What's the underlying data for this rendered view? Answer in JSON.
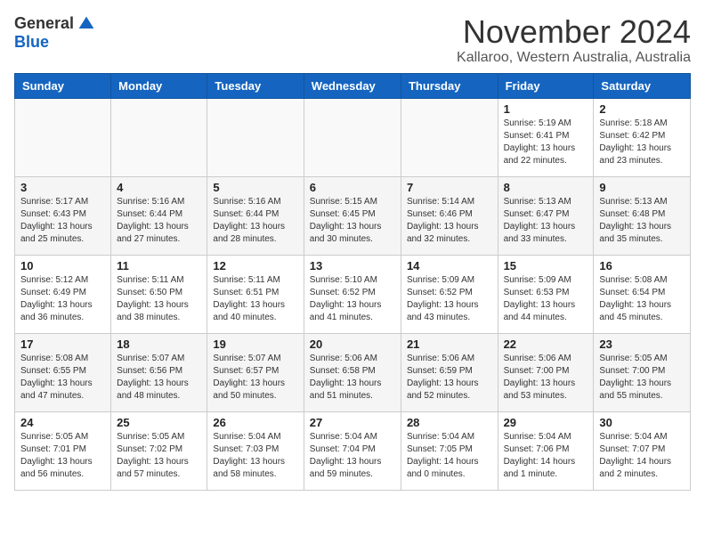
{
  "logo": {
    "general": "General",
    "blue": "Blue"
  },
  "title": "November 2024",
  "location": "Kallaroo, Western Australia, Australia",
  "headers": [
    "Sunday",
    "Monday",
    "Tuesday",
    "Wednesday",
    "Thursday",
    "Friday",
    "Saturday"
  ],
  "weeks": [
    [
      {
        "day": "",
        "info": ""
      },
      {
        "day": "",
        "info": ""
      },
      {
        "day": "",
        "info": ""
      },
      {
        "day": "",
        "info": ""
      },
      {
        "day": "",
        "info": ""
      },
      {
        "day": "1",
        "info": "Sunrise: 5:19 AM\nSunset: 6:41 PM\nDaylight: 13 hours\nand 22 minutes."
      },
      {
        "day": "2",
        "info": "Sunrise: 5:18 AM\nSunset: 6:42 PM\nDaylight: 13 hours\nand 23 minutes."
      }
    ],
    [
      {
        "day": "3",
        "info": "Sunrise: 5:17 AM\nSunset: 6:43 PM\nDaylight: 13 hours\nand 25 minutes."
      },
      {
        "day": "4",
        "info": "Sunrise: 5:16 AM\nSunset: 6:44 PM\nDaylight: 13 hours\nand 27 minutes."
      },
      {
        "day": "5",
        "info": "Sunrise: 5:16 AM\nSunset: 6:44 PM\nDaylight: 13 hours\nand 28 minutes."
      },
      {
        "day": "6",
        "info": "Sunrise: 5:15 AM\nSunset: 6:45 PM\nDaylight: 13 hours\nand 30 minutes."
      },
      {
        "day": "7",
        "info": "Sunrise: 5:14 AM\nSunset: 6:46 PM\nDaylight: 13 hours\nand 32 minutes."
      },
      {
        "day": "8",
        "info": "Sunrise: 5:13 AM\nSunset: 6:47 PM\nDaylight: 13 hours\nand 33 minutes."
      },
      {
        "day": "9",
        "info": "Sunrise: 5:13 AM\nSunset: 6:48 PM\nDaylight: 13 hours\nand 35 minutes."
      }
    ],
    [
      {
        "day": "10",
        "info": "Sunrise: 5:12 AM\nSunset: 6:49 PM\nDaylight: 13 hours\nand 36 minutes."
      },
      {
        "day": "11",
        "info": "Sunrise: 5:11 AM\nSunset: 6:50 PM\nDaylight: 13 hours\nand 38 minutes."
      },
      {
        "day": "12",
        "info": "Sunrise: 5:11 AM\nSunset: 6:51 PM\nDaylight: 13 hours\nand 40 minutes."
      },
      {
        "day": "13",
        "info": "Sunrise: 5:10 AM\nSunset: 6:52 PM\nDaylight: 13 hours\nand 41 minutes."
      },
      {
        "day": "14",
        "info": "Sunrise: 5:09 AM\nSunset: 6:52 PM\nDaylight: 13 hours\nand 43 minutes."
      },
      {
        "day": "15",
        "info": "Sunrise: 5:09 AM\nSunset: 6:53 PM\nDaylight: 13 hours\nand 44 minutes."
      },
      {
        "day": "16",
        "info": "Sunrise: 5:08 AM\nSunset: 6:54 PM\nDaylight: 13 hours\nand 45 minutes."
      }
    ],
    [
      {
        "day": "17",
        "info": "Sunrise: 5:08 AM\nSunset: 6:55 PM\nDaylight: 13 hours\nand 47 minutes."
      },
      {
        "day": "18",
        "info": "Sunrise: 5:07 AM\nSunset: 6:56 PM\nDaylight: 13 hours\nand 48 minutes."
      },
      {
        "day": "19",
        "info": "Sunrise: 5:07 AM\nSunset: 6:57 PM\nDaylight: 13 hours\nand 50 minutes."
      },
      {
        "day": "20",
        "info": "Sunrise: 5:06 AM\nSunset: 6:58 PM\nDaylight: 13 hours\nand 51 minutes."
      },
      {
        "day": "21",
        "info": "Sunrise: 5:06 AM\nSunset: 6:59 PM\nDaylight: 13 hours\nand 52 minutes."
      },
      {
        "day": "22",
        "info": "Sunrise: 5:06 AM\nSunset: 7:00 PM\nDaylight: 13 hours\nand 53 minutes."
      },
      {
        "day": "23",
        "info": "Sunrise: 5:05 AM\nSunset: 7:00 PM\nDaylight: 13 hours\nand 55 minutes."
      }
    ],
    [
      {
        "day": "24",
        "info": "Sunrise: 5:05 AM\nSunset: 7:01 PM\nDaylight: 13 hours\nand 56 minutes."
      },
      {
        "day": "25",
        "info": "Sunrise: 5:05 AM\nSunset: 7:02 PM\nDaylight: 13 hours\nand 57 minutes."
      },
      {
        "day": "26",
        "info": "Sunrise: 5:04 AM\nSunset: 7:03 PM\nDaylight: 13 hours\nand 58 minutes."
      },
      {
        "day": "27",
        "info": "Sunrise: 5:04 AM\nSunset: 7:04 PM\nDaylight: 13 hours\nand 59 minutes."
      },
      {
        "day": "28",
        "info": "Sunrise: 5:04 AM\nSunset: 7:05 PM\nDaylight: 14 hours\nand 0 minutes."
      },
      {
        "day": "29",
        "info": "Sunrise: 5:04 AM\nSunset: 7:06 PM\nDaylight: 14 hours\nand 1 minute."
      },
      {
        "day": "30",
        "info": "Sunrise: 5:04 AM\nSunset: 7:07 PM\nDaylight: 14 hours\nand 2 minutes."
      }
    ]
  ]
}
